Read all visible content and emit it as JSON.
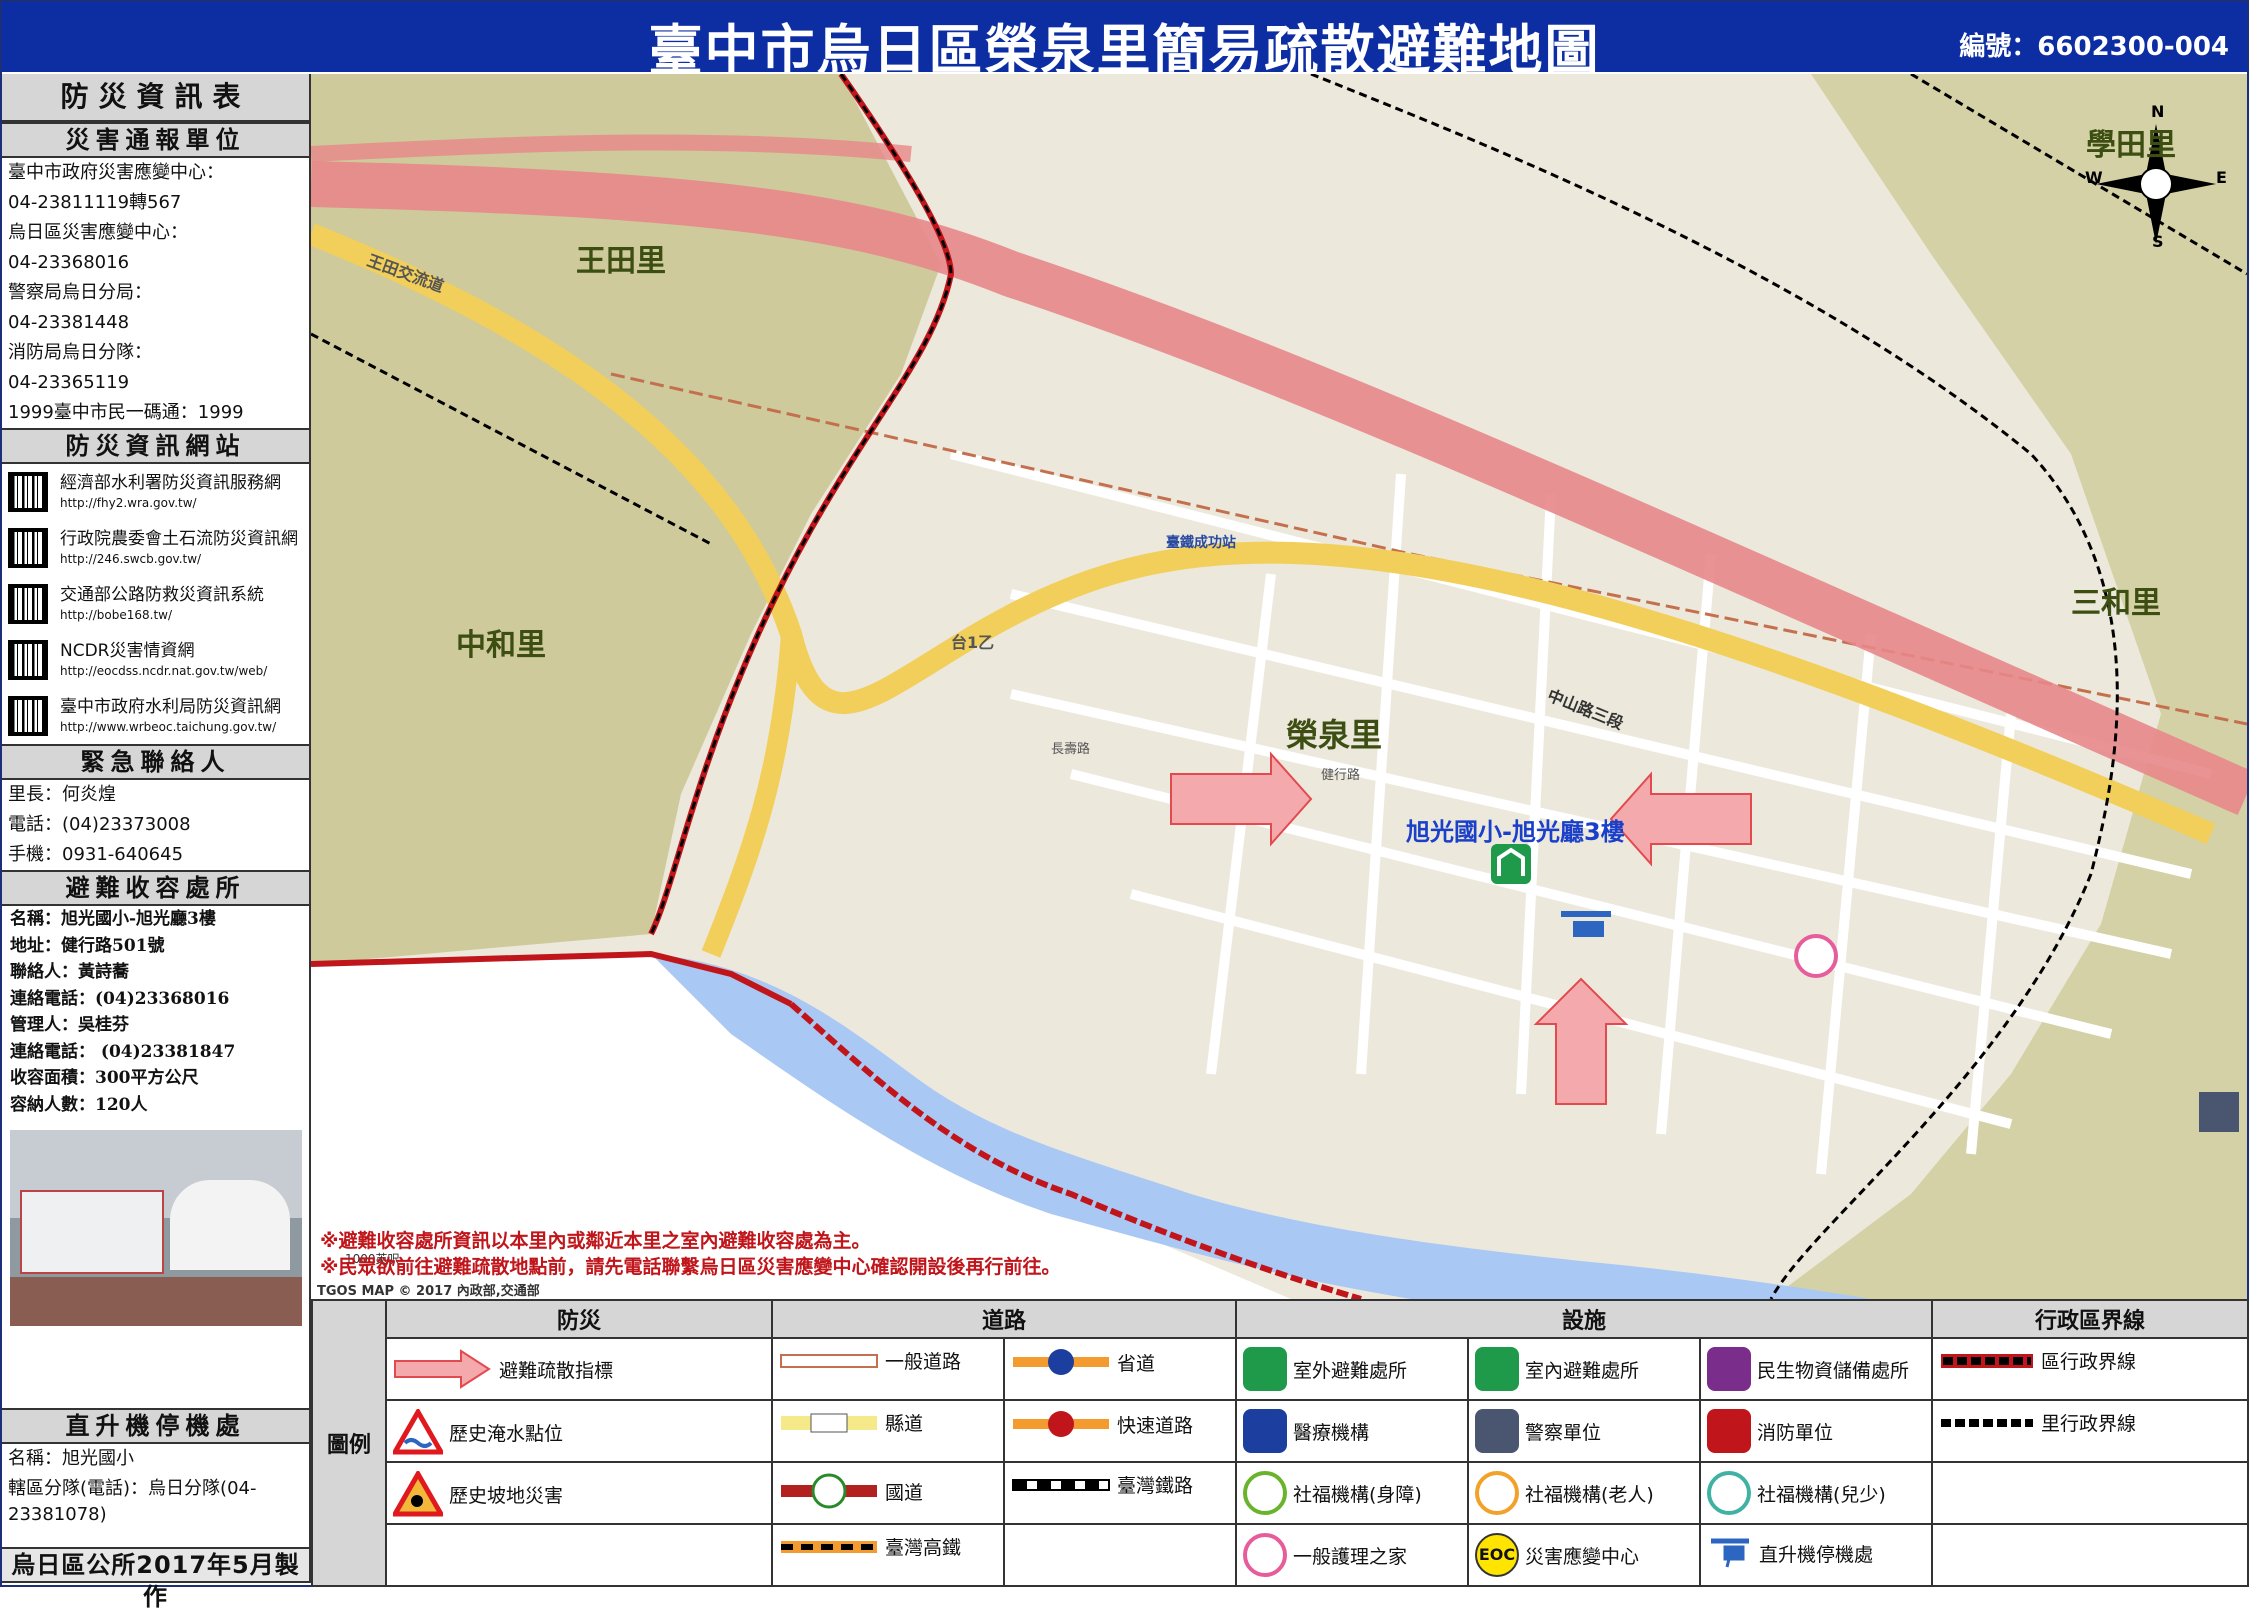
{
  "title": "臺中市烏日區榮泉里簡易疏散避難地圖",
  "code": "編號：6602300-004",
  "sidebar": {
    "header": "防災資訊表",
    "report": {
      "header": "災害通報單位",
      "lines": [
        "臺中市政府災害應變中心：",
        "04-23811119轉567",
        "烏日區災害應變中心：",
        "04-23368016",
        "警察局烏日分局：",
        "04-23381448",
        "消防局烏日分隊：",
        "04-23365119",
        "1999臺中市民一碼通：1999"
      ]
    },
    "web": {
      "header": "防災資訊網站",
      "sites": [
        {
          "name": "經濟部水利署防災資訊服務網",
          "url": "http://fhy2.wra.gov.tw/"
        },
        {
          "name": "行政院農委會土石流防災資訊網",
          "url": "http://246.swcb.gov.tw/"
        },
        {
          "name": "交通部公路防救災資訊系統",
          "url": "http://bobe168.tw/"
        },
        {
          "name": "NCDR災害情資網",
          "url": "http://eocdss.ncdr.nat.gov.tw/web/"
        },
        {
          "name": "臺中市政府水利局防災資訊網",
          "url": "http://www.wrbeoc.taichung.gov.tw/"
        }
      ]
    },
    "contact": {
      "header": "緊急聯絡人",
      "lines": [
        "里長：何炎煌",
        "電話：(04)23373008",
        "手機：0931-640645"
      ]
    },
    "shelter": {
      "header": "避難收容處所",
      "lines": [
        "名稱：旭光國小-旭光廳3樓",
        "地址：健行路501號",
        "聯絡人：黃詩蕎",
        "連絡電話：(04)23368016",
        "管理人：吳桂芬",
        "連絡電話： (04)23381847",
        "收容面積：300平方公尺",
        "容納人數：120人"
      ]
    },
    "heli": {
      "header": "直升機停機處",
      "lines": [
        "名稱：旭光國小",
        "轄區分隊(電話)：烏日分隊(04-",
        "23381078)"
      ]
    },
    "footer": "烏日區公所2017年5月製作"
  },
  "map": {
    "labels": [
      "王田里",
      "中和里",
      "榮泉里",
      "三和里",
      "學田里"
    ],
    "shelter_label": "旭光國小-旭光廳3樓",
    "roads": [
      "中山路三段",
      "台1乙",
      "王田交流道",
      "臺鐵成功站",
      "長壽路",
      "健行路"
    ],
    "compass": [
      "N",
      "S",
      "E",
      "W"
    ],
    "scale": "1000英呎",
    "copyright": "TGOS MAP © 2017 內政部,交通部",
    "notes": [
      "※避難收容處所資訊以本里內或鄰近本里之室內避難收容處為主。",
      "※民眾欲前往避難疏散地點前，請先電話聯繫烏日區災害應變中心確認開設後再行前往。"
    ]
  },
  "legend": {
    "label": "圖例",
    "headers": [
      "防災",
      "道路",
      "設施",
      "行政區界線"
    ],
    "disaster": [
      "避難疏散指標",
      "歷史淹水點位",
      "歷史坡地災害"
    ],
    "roads": [
      "一般道路",
      "省道",
      "縣道",
      "快速道路",
      "國道",
      "臺灣鐵路",
      "臺灣高鐵"
    ],
    "facilities": [
      "室外避難處所",
      "室內避難處所",
      "民生物資儲備處所",
      "醫療機構",
      "警察單位",
      "消防單位",
      "社福機構(身障)",
      "社福機構(老人)",
      "社福機構(兒少)",
      "一般護理之家",
      "災害應變中心",
      "直升機停機處"
    ],
    "eoc": "EOC",
    "bounds": [
      "區行政界線",
      "里行政界線"
    ]
  },
  "colors": {
    "title_bg": "#0d2da3",
    "expressway": "#e8878a",
    "provincial": "#f2cf5a",
    "river": "#aac8f4",
    "boundary": "#c0151a"
  }
}
